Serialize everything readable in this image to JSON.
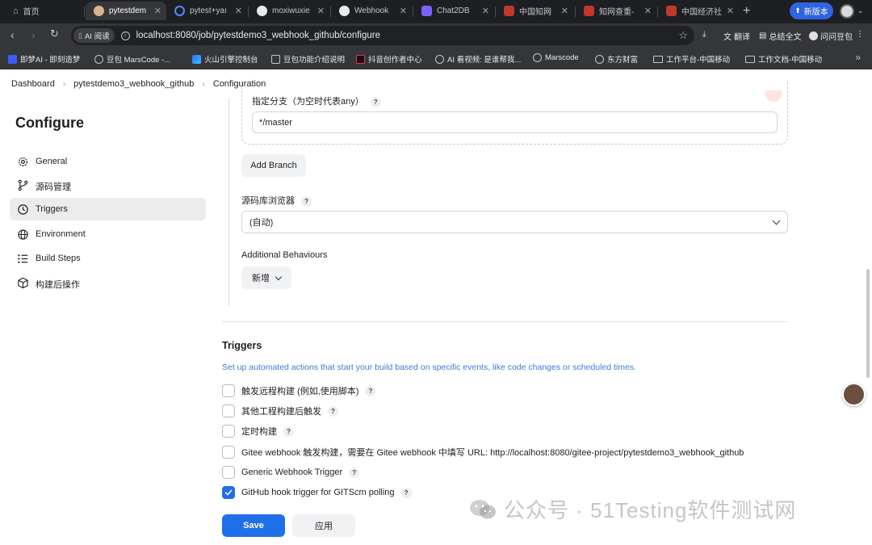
{
  "browser": {
    "tabs": [
      {
        "label": "首页"
      },
      {
        "label": "pytestdem"
      },
      {
        "label": "pytest+yaı"
      },
      {
        "label": "moxiwuxie"
      },
      {
        "label": "Webhook"
      },
      {
        "label": "Chat2DB"
      },
      {
        "label": "中国知网"
      },
      {
        "label": "知网查重-"
      },
      {
        "label": "中国经济社"
      }
    ],
    "new_tab": "+",
    "new_version": "新版本",
    "ai_read": "AI 阅读",
    "url": "localhost:8080/job/pytestdemo3_webhook_github/configure",
    "toolbar_right": {
      "translate": "翻译",
      "summary": "总结全文",
      "ask": "问问豆包"
    },
    "bookmarks": [
      {
        "label": "即梦AI - 即刻造梦"
      },
      {
        "label": "豆包 MarsCode -..."
      },
      {
        "label": "火山引擎控制台"
      },
      {
        "label": "豆包功能介绍说明"
      },
      {
        "label": "抖音创作者中心"
      },
      {
        "label": "AI 看视频: 是谁帮我..."
      },
      {
        "label": "Marscode"
      },
      {
        "label": "东方财富"
      },
      {
        "label": "工作平台-中国移动"
      },
      {
        "label": "工作文档-中国移动"
      }
    ]
  },
  "breadcrumb": [
    "Dashboard",
    "pytestdemo3_webhook_github",
    "Configuration"
  ],
  "sidebar": {
    "title": "Configure",
    "items": [
      {
        "label": "General"
      },
      {
        "label": "源码管理"
      },
      {
        "label": "Triggers"
      },
      {
        "label": "Environment"
      },
      {
        "label": "Build Steps"
      },
      {
        "label": "构建后操作"
      }
    ]
  },
  "scm": {
    "branch_label": "指定分支（为空时代表any）",
    "branch_value": "*/master",
    "add_branch": "Add Branch",
    "browser_label": "源码库浏览器",
    "browser_value": "(自动)",
    "additional_behaviours": "Additional Behaviours",
    "add_new": "新增"
  },
  "triggers": {
    "title": "Triggers",
    "description": "Set up automated actions that start your build based on specific events, like code changes or scheduled times.",
    "options": [
      {
        "label": "触发远程构建 (例如,使用脚本)",
        "checked": false,
        "help": "?"
      },
      {
        "label": "其他工程构建后触发",
        "checked": false,
        "help": "?"
      },
      {
        "label": "定时构建",
        "checked": false,
        "help": "?"
      },
      {
        "label": "Gitee webhook 触发构建，需要在 Gitee webhook 中填写 URL: http://localhost:8080/gitee-project/pytestdemo3_webhook_github",
        "checked": false,
        "help": ""
      },
      {
        "label": "Generic Webhook Trigger",
        "checked": false,
        "help": "?"
      },
      {
        "label": "GitHub hook trigger for GITScm polling",
        "checked": true,
        "help": "?"
      }
    ]
  },
  "actions": {
    "save": "Save",
    "apply": "应用"
  },
  "watermark": "公众号 · 51Testing软件测试网",
  "colors": {
    "primary": "#1f6feb",
    "link": "#3a7bd5",
    "active_bg": "#eaecee"
  }
}
